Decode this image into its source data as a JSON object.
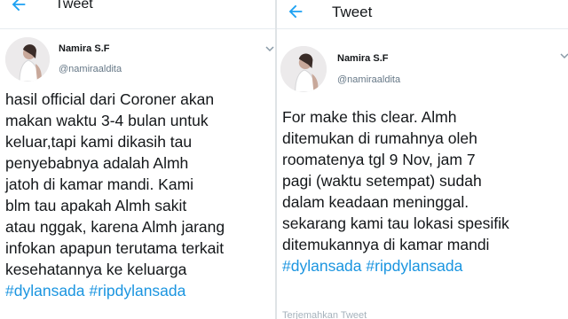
{
  "colors": {
    "accent": "#1da1f2",
    "hashtag": "#1b95e0",
    "text": "#14171a",
    "muted": "#657786"
  },
  "left": {
    "header": {
      "title": "Tweet",
      "back_icon": "back-arrow-icon"
    },
    "author": {
      "name": "Namira S.F",
      "handle": "@namiraaldita"
    },
    "body_lines": [
      "hasil official dari Coroner akan",
      "makan waktu 3-4 bulan untuk",
      "keluar,tapi kami dikasih tau",
      "penyebabnya adalah Almh",
      "jatoh di kamar mandi. Kami",
      "blm tau apakah Almh sakit",
      "atau nggak, karena Almh jarang",
      "infokan apapun terutama terkait",
      "kesehatannya ke keluarga"
    ],
    "hashtags": [
      "#dylansada",
      "#ripdylansada"
    ]
  },
  "right": {
    "header": {
      "title": "Tweet",
      "back_icon": "back-arrow-icon"
    },
    "author": {
      "name": "Namira S.F",
      "handle": "@namiraaldita"
    },
    "body_lines": [
      "For make this clear. Almh",
      "ditemukan di rumahnya oleh",
      "roomatenya tgl 9 Nov, jam 7",
      "pagi (waktu setempat) sudah",
      "dalam keadaan meninggal.",
      "sekarang kami tau lokasi spesifik",
      "ditemukannya di kamar mandi"
    ],
    "hashtags": [
      "#dylansada",
      "#ripdylansada"
    ],
    "footer": "Terjemahkan Tweet"
  }
}
